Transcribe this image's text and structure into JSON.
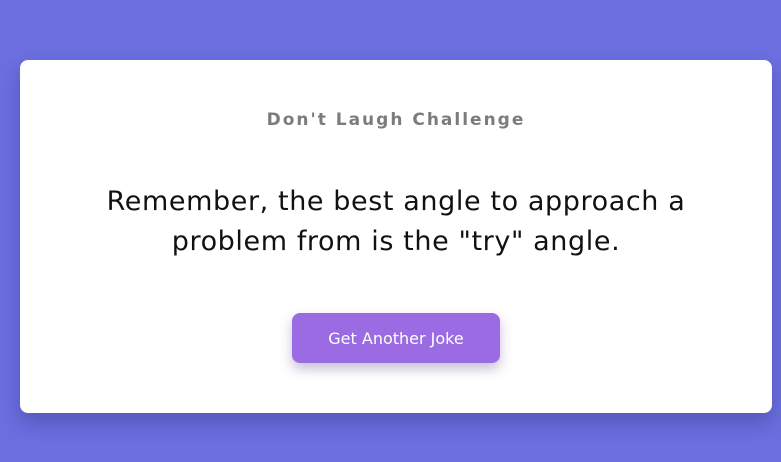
{
  "card": {
    "subtitle": "Don't Laugh Challenge",
    "joke": "Remember, the best angle to approach a problem from is the \"try\" angle.",
    "button_label": "Get Another Joke"
  },
  "colors": {
    "background": "#6b6fe0",
    "card": "#ffffff",
    "button": "#9b6be3",
    "subtitle_text": "#7c7c7c",
    "joke_text": "#111111"
  }
}
